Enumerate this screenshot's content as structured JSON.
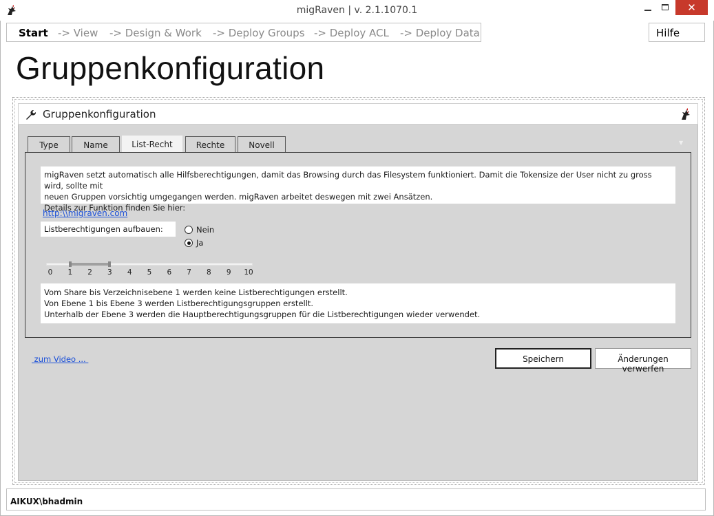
{
  "window": {
    "title": "migRaven | v. 2.1.1070.1",
    "icon": "rooster-logo-icon",
    "controls": {
      "minimize": "minimize-icon",
      "maximize": "maximize-icon",
      "close": "✕"
    }
  },
  "nav": {
    "items": [
      {
        "label": "Start",
        "active": true
      },
      {
        "label": "-> View",
        "active": false
      },
      {
        "label": "-> Design & Work",
        "active": false
      },
      {
        "label": "-> Deploy Groups",
        "active": false
      },
      {
        "label": "-> Deploy ACL",
        "active": false
      },
      {
        "label": "-> Deploy Data",
        "active": false
      }
    ],
    "help_label": "Hilfe"
  },
  "page_title": "Gruppenkonfiguration",
  "panel": {
    "title": "Gruppenkonfiguration",
    "tabs": [
      {
        "label": "Type",
        "active": false
      },
      {
        "label": "Name",
        "active": false
      },
      {
        "label": "List-Recht",
        "active": true
      },
      {
        "label": "Rechte",
        "active": false
      },
      {
        "label": "Novell",
        "active": false
      }
    ],
    "dropdown_glyph": "▼"
  },
  "list_recht": {
    "info_lines": [
      "migRaven setzt automatisch alle Hilfsberechtigungen, damit das Browsing durch das Filesystem funktioniert. Damit die Tokensize der User nicht zu gross wird, sollte mit",
      "neuen Gruppen vorsichtig umgegangen werden. migRaven arbeitet deswegen mit zwei Ansätzen.",
      "Details zur Funktion finden Sie hier:"
    ],
    "link": "http:\\\\migraven.com",
    "option_label": "Listberechtigungen aufbauen:",
    "radios": [
      {
        "label": "Nein",
        "checked": false
      },
      {
        "label": "Ja",
        "checked": true
      }
    ],
    "slider": {
      "ticks": [
        "0",
        "1",
        "2",
        "3",
        "4",
        "5",
        "6",
        "7",
        "8",
        "9",
        "10"
      ],
      "min": 0,
      "max": 10,
      "range_start": 1,
      "range_end": 3
    },
    "result_lines": [
      "Vom Share bis Verzeichnisebene 1 werden keine Listberechtigungen erstellt.",
      "Von Ebene 1 bis Ebene 3 werden Listberechtigungsgruppen erstellt.",
      "Unterhalb der Ebene 3 werden die Hauptberechtigungsgruppen für die Listberechtigungen wieder verwendet."
    ]
  },
  "footer": {
    "video_link": " zum Video ... ",
    "save_label": "Speichern",
    "discard_label": "Änderungen verwerfen"
  },
  "status": {
    "user": "AIKUX\\bhadmin"
  },
  "colors": {
    "close_button": "#c7392b",
    "link": "#1a4fd8",
    "panel_bg": "#d6d6d6"
  }
}
